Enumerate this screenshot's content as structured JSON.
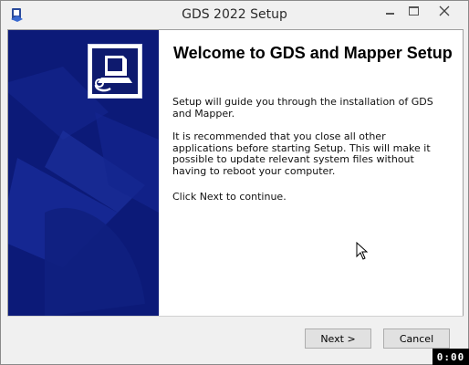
{
  "window": {
    "title": "GDS 2022 Setup",
    "icon": "installer-app-icon"
  },
  "controls": {
    "minimize_icon": "minimize-icon",
    "maximize_icon": "maximize-icon",
    "close_icon": "close-icon"
  },
  "main": {
    "heading": "Welcome to GDS and Mapper Setup",
    "paragraph1": "Setup will guide you through the installation of GDS and Mapper.",
    "paragraph2": "It is recommended that you close all other applications before starting Setup. This will make it possible to update relevant system files without having to reboot your computer.",
    "paragraph3": "Click Next to continue."
  },
  "buttons": {
    "next": "Next >",
    "cancel": "Cancel"
  },
  "overlay": {
    "timer": "0:00"
  },
  "colors": {
    "side_panel": "#0c1a78",
    "side_panel_light": "#1a2a9a"
  }
}
